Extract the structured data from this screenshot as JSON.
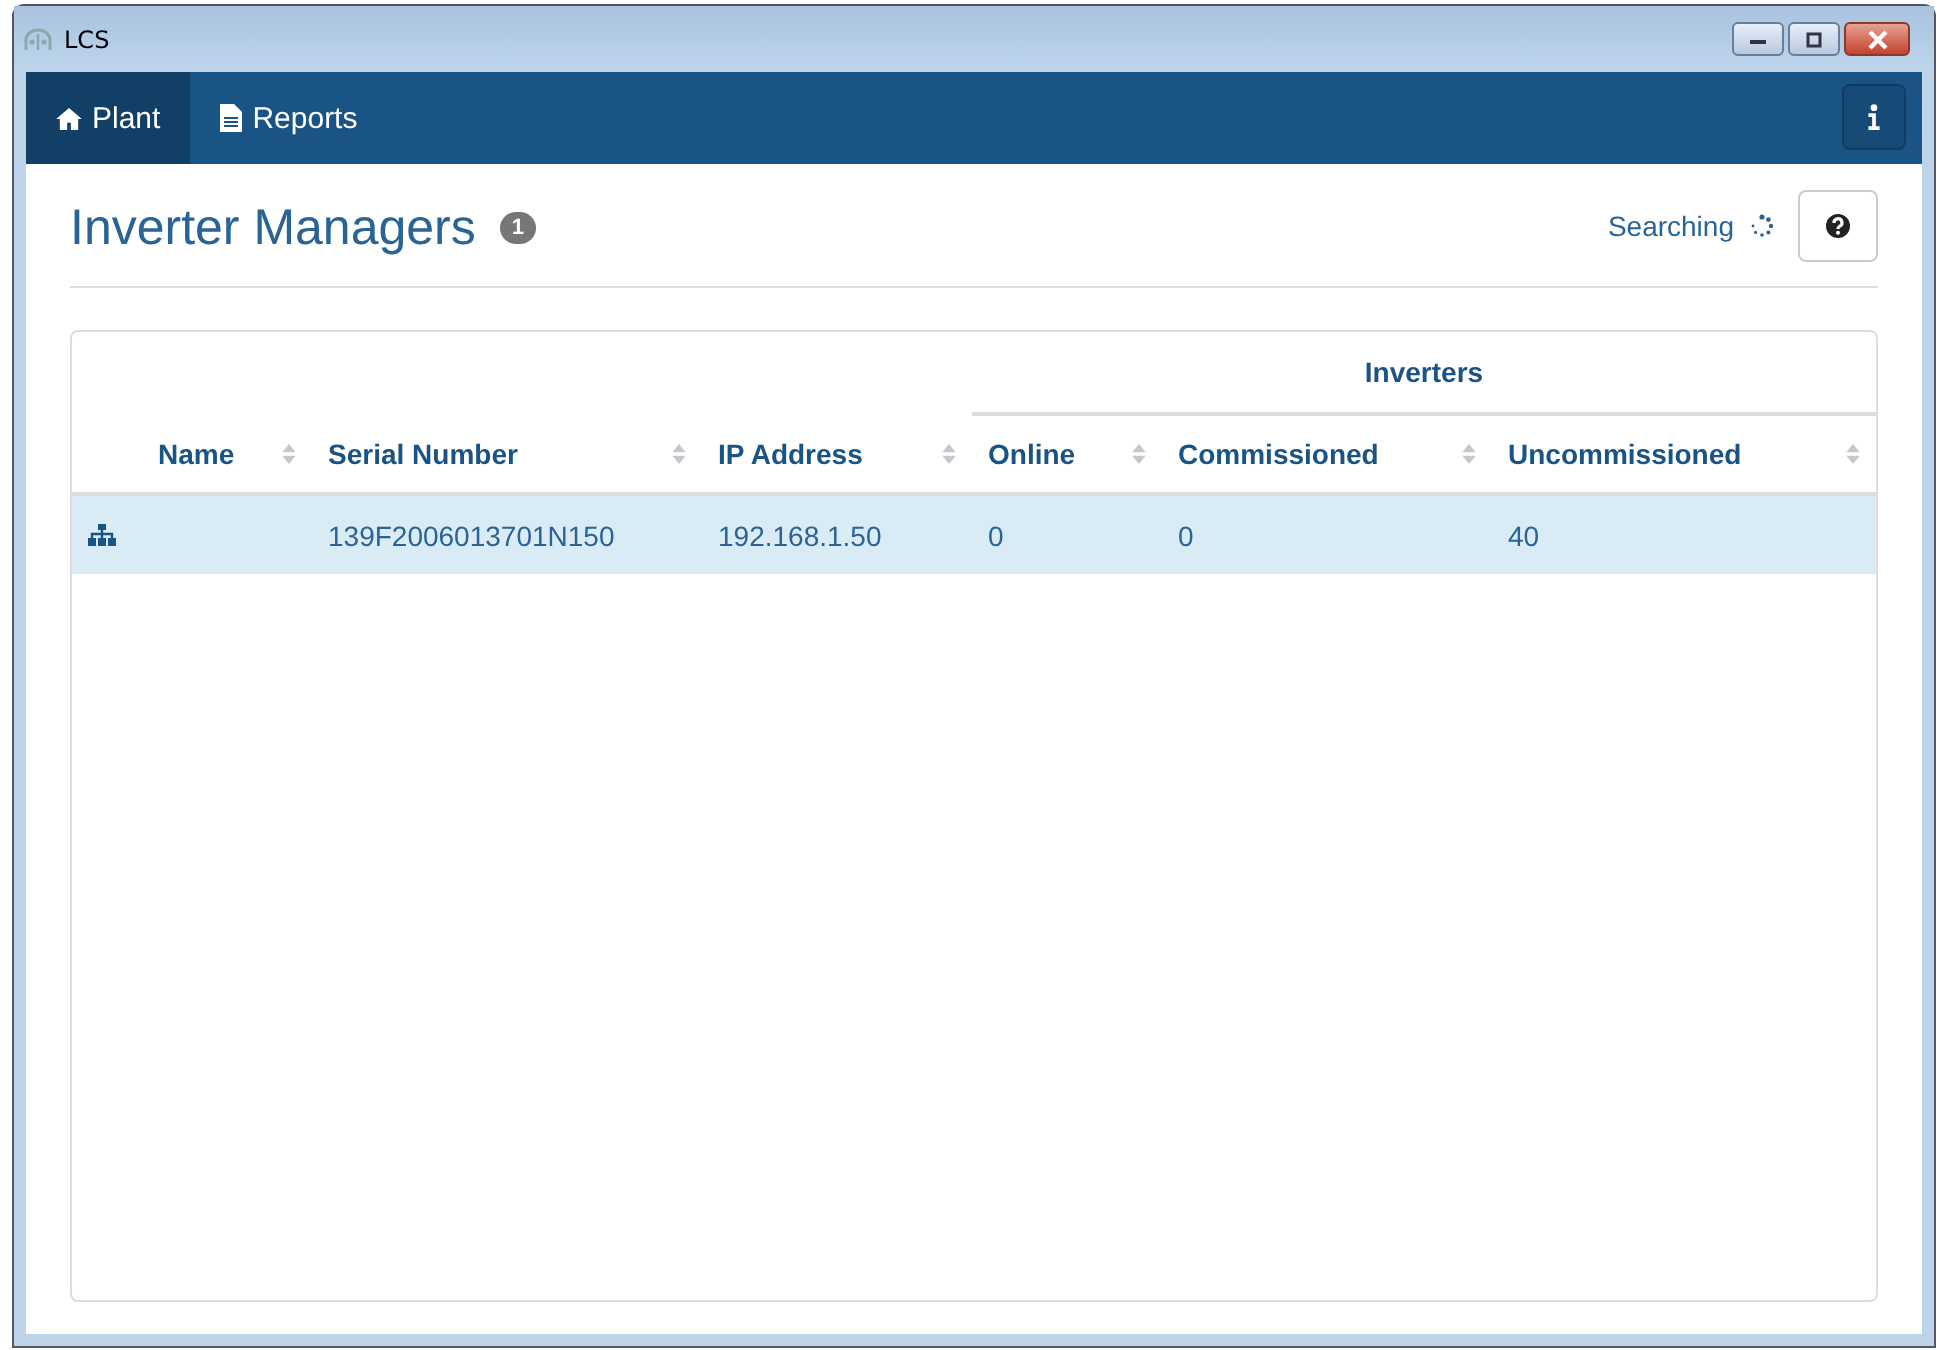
{
  "window": {
    "title": "LCS"
  },
  "nav": {
    "tabs": [
      {
        "label": "Plant",
        "kind": "home",
        "selected": true
      },
      {
        "label": "Reports",
        "kind": "document",
        "selected": false
      }
    ]
  },
  "page": {
    "title": "Inverter Managers",
    "count": "1",
    "status": "Searching"
  },
  "table": {
    "group_header": "Inverters",
    "columns": [
      "Name",
      "Serial Number",
      "IP Address",
      "Online",
      "Commissioned",
      "Uncommissioned"
    ],
    "rows": [
      {
        "selected": true,
        "cells": [
          "",
          "139F2006013701N150",
          "192.168.1.50",
          "0",
          "0",
          "40"
        ]
      }
    ]
  }
}
